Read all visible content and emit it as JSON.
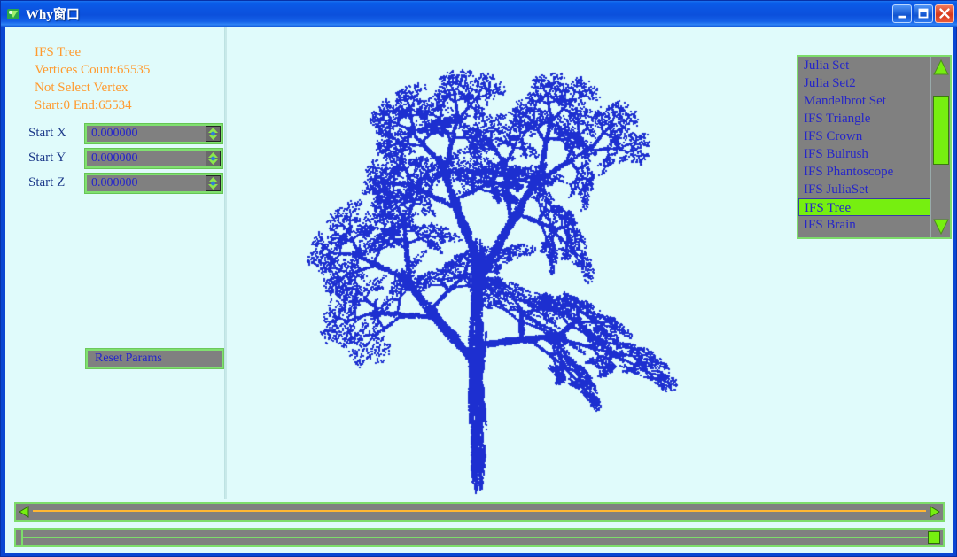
{
  "window": {
    "title": "Why窗口",
    "icon": "app-icon",
    "background_color": "#e0fbfb",
    "titlebar_color": "#0b55e2",
    "controls": {
      "minimize_label": "Minimize",
      "maximize_label": "Maximize",
      "close_label": "Close"
    }
  },
  "left_panel": {
    "info": [
      "IFS Tree",
      "Vertices Count:65535",
      "Not Select Vertex",
      "Start:0 End:65534"
    ],
    "info_color": "#ff9a2e",
    "fields": [
      {
        "label": "Start X",
        "value": "0.000000"
      },
      {
        "label": "Start Y",
        "value": "0.000000"
      },
      {
        "label": "Start Z",
        "value": "0.000000"
      }
    ],
    "reset_button": "Reset Params"
  },
  "canvas": {
    "fractal_name": "IFS Tree",
    "point_color": "#1d2fd0",
    "background_color": "#e0fbfb"
  },
  "fractal_list": {
    "items": [
      "Julia Set",
      "Julia Set2",
      "Mandelbrot Set",
      "IFS Triangle",
      "IFS Crown",
      "IFS Bulrush",
      "IFS Phantoscope",
      "IFS JuliaSet",
      "IFS Tree",
      "IFS Brain"
    ],
    "selected_index": 8,
    "selected_value": "IFS Tree",
    "highlight_color": "#76ef10"
  },
  "bottom": {
    "hscroll_name": "horizontal-scrollbar",
    "trackbar_name": "position-trackbar",
    "accent_color": "#7ddd6b"
  }
}
